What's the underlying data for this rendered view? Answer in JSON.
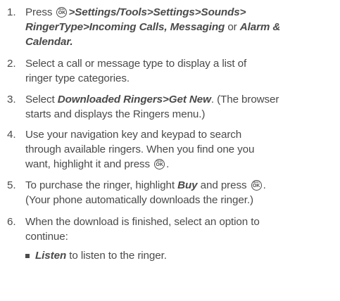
{
  "key_icon": {
    "top_label": "MENU",
    "bottom_label": "OK"
  },
  "steps": [
    {
      "number": "1.",
      "press": "Press",
      "path_a": ">Settings/Tools>Settings>Sounds>",
      "path_b": "RingerType>Incoming Calls, Messaging",
      "or": "or",
      "alarm": "Alarm &",
      "calendar": "Calendar."
    },
    {
      "number": "2.",
      "line1": "Select a call or message type to display a list of",
      "line2": "ringer type categories."
    },
    {
      "number": "3.",
      "select": "Select",
      "path": "Downloaded Ringers>Get New",
      "rest1": ". (The browser",
      "line2": "starts and displays the Ringers menu.)"
    },
    {
      "number": "4.",
      "line1": "Use your navigation key and keypad to search",
      "line2": "through available ringers. When you find one you",
      "line3": "want, highlight it and press",
      "line3_end": "."
    },
    {
      "number": "5.",
      "line1a": "To purchase the ringer, highlight",
      "buy": "Buy",
      "line1b": "and press",
      "line1_end": ".",
      "line2": "(Your phone automatically downloads the ringer.)"
    },
    {
      "number": "6.",
      "line1": "When the download is finished, select an option to",
      "line2": "continue:"
    }
  ],
  "bullets": [
    {
      "term": "Listen",
      "text": "to listen to the ringer."
    }
  ],
  "colors": {
    "text": "#4a4a4a",
    "background": "#ffffff"
  }
}
